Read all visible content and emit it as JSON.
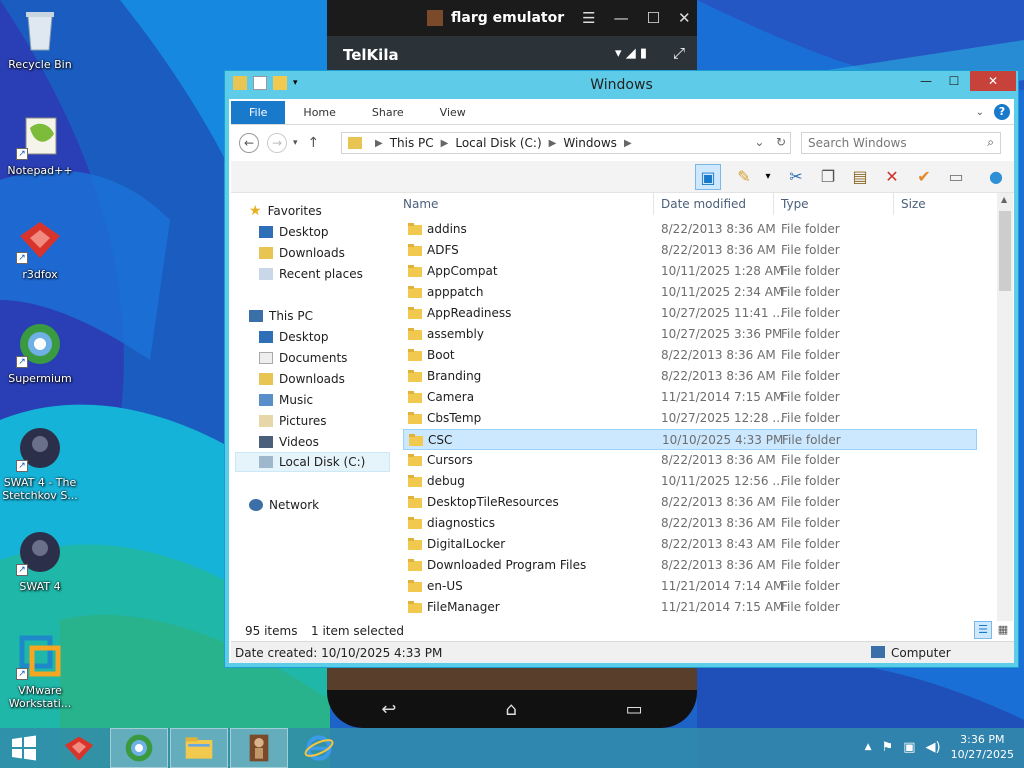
{
  "desktop": {
    "icons": [
      {
        "label": "Recycle Bin"
      },
      {
        "label": "Notepad++"
      },
      {
        "label": "r3dfox"
      },
      {
        "label": "Supermium"
      },
      {
        "label": "SWAT 4 - The Stetchkov S..."
      },
      {
        "label": "SWAT 4"
      },
      {
        "label": "VMware Workstati..."
      }
    ]
  },
  "emulator": {
    "title": "flarg emulator",
    "app_name": "TelKila"
  },
  "explorer": {
    "title": "Windows",
    "tabs": [
      "File",
      "Home",
      "Share",
      "View"
    ],
    "breadcrumb": [
      "This PC",
      "Local Disk (C:)",
      "Windows"
    ],
    "search_placeholder": "Search Windows",
    "columns": [
      "Name",
      "Date modified",
      "Type",
      "Size"
    ],
    "nav": {
      "favorites": "Favorites",
      "fav_items": [
        "Desktop",
        "Downloads",
        "Recent places"
      ],
      "this_pc": "This PC",
      "pc_items": [
        "Desktop",
        "Documents",
        "Downloads",
        "Music",
        "Pictures",
        "Videos",
        "Local Disk (C:)"
      ],
      "network": "Network"
    },
    "rows": [
      {
        "name": "addins",
        "date": "8/22/2013 8:36 AM",
        "type": "File folder"
      },
      {
        "name": "ADFS",
        "date": "8/22/2013 8:36 AM",
        "type": "File folder"
      },
      {
        "name": "AppCompat",
        "date": "10/11/2025 1:28 AM",
        "type": "File folder"
      },
      {
        "name": "apppatch",
        "date": "10/11/2025 2:34 AM",
        "type": "File folder"
      },
      {
        "name": "AppReadiness",
        "date": "10/27/2025 11:41 ...",
        "type": "File folder"
      },
      {
        "name": "assembly",
        "date": "10/27/2025 3:36 PM",
        "type": "File folder"
      },
      {
        "name": "Boot",
        "date": "8/22/2013 8:36 AM",
        "type": "File folder"
      },
      {
        "name": "Branding",
        "date": "8/22/2013 8:36 AM",
        "type": "File folder"
      },
      {
        "name": "Camera",
        "date": "11/21/2014 7:15 AM",
        "type": "File folder"
      },
      {
        "name": "CbsTemp",
        "date": "10/27/2025 12:28 ...",
        "type": "File folder"
      },
      {
        "name": "CSC",
        "date": "10/10/2025 4:33 PM",
        "type": "File folder"
      },
      {
        "name": "Cursors",
        "date": "8/22/2013 8:36 AM",
        "type": "File folder"
      },
      {
        "name": "debug",
        "date": "10/11/2025 12:56 ...",
        "type": "File folder"
      },
      {
        "name": "DesktopTileResources",
        "date": "8/22/2013 8:36 AM",
        "type": "File folder"
      },
      {
        "name": "diagnostics",
        "date": "8/22/2013 8:36 AM",
        "type": "File folder"
      },
      {
        "name": "DigitalLocker",
        "date": "8/22/2013 8:43 AM",
        "type": "File folder"
      },
      {
        "name": "Downloaded Program Files",
        "date": "8/22/2013 8:36 AM",
        "type": "File folder"
      },
      {
        "name": "en-US",
        "date": "11/21/2014 7:14 AM",
        "type": "File folder"
      },
      {
        "name": "FileManager",
        "date": "11/21/2014 7:15 AM",
        "type": "File folder"
      }
    ],
    "status": {
      "items": "95 items",
      "selected": "1 item selected"
    },
    "details": {
      "date_created": "Date created: 10/10/2025 4:33 PM",
      "location": "Computer"
    }
  },
  "taskbar": {
    "time": "3:36 PM",
    "date": "10/27/2025"
  }
}
